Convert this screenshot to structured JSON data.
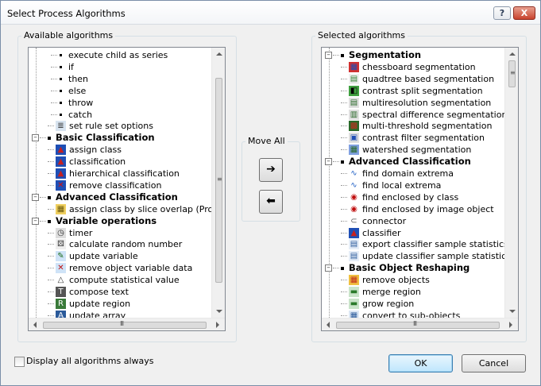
{
  "window": {
    "title": "Select Process Algorithms",
    "help_label": "?",
    "close_label": "X"
  },
  "available": {
    "label": "Available algorithms",
    "rows": [
      {
        "kind": "item",
        "level": 3,
        "text": "execute child as series",
        "icon": ""
      },
      {
        "kind": "item",
        "level": 3,
        "text": "if",
        "icon": ""
      },
      {
        "kind": "item",
        "level": 3,
        "text": "then",
        "icon": ""
      },
      {
        "kind": "item",
        "level": 3,
        "text": "else",
        "icon": ""
      },
      {
        "kind": "item",
        "level": 3,
        "text": "throw",
        "icon": ""
      },
      {
        "kind": "item",
        "level": 3,
        "text": "catch",
        "icon": ""
      },
      {
        "kind": "item",
        "level": 2,
        "text": "set rule set options",
        "icon": "rule-set-options-icon"
      },
      {
        "kind": "cat",
        "text": "Basic Classification"
      },
      {
        "kind": "item",
        "level": 2,
        "text": "assign class",
        "icon": "assign-class-icon"
      },
      {
        "kind": "item",
        "level": 2,
        "text": "classification",
        "icon": "classification-icon"
      },
      {
        "kind": "item",
        "level": 2,
        "text": "hierarchical classification",
        "icon": "hierarchical-classification-icon"
      },
      {
        "kind": "item",
        "level": 2,
        "text": "remove classification",
        "icon": "remove-classification-icon"
      },
      {
        "kind": "cat",
        "text": "Advanced Classification"
      },
      {
        "kind": "item",
        "level": 2,
        "text": "assign class by slice overlap (Prototy",
        "icon": "slice-overlap-icon"
      },
      {
        "kind": "cat",
        "text": "Variable operations"
      },
      {
        "kind": "item",
        "level": 2,
        "text": "timer",
        "icon": "timer-icon"
      },
      {
        "kind": "item",
        "level": 2,
        "text": "calculate random number",
        "icon": "random-number-icon"
      },
      {
        "kind": "item",
        "level": 2,
        "text": "update variable",
        "icon": "update-variable-icon"
      },
      {
        "kind": "item",
        "level": 2,
        "text": "remove object variable data",
        "icon": "remove-variable-icon"
      },
      {
        "kind": "item",
        "level": 2,
        "text": "compute statistical value",
        "icon": "statistics-icon"
      },
      {
        "kind": "item",
        "level": 2,
        "text": "compose text",
        "icon": "compose-text-icon"
      },
      {
        "kind": "item",
        "level": 2,
        "text": "update region",
        "icon": "update-region-icon"
      },
      {
        "kind": "item",
        "level": 2,
        "text": "update array",
        "icon": "update-array-icon"
      }
    ]
  },
  "move_all": {
    "label": "Move All",
    "right_arrow": "➔",
    "left_arrow": "⬅"
  },
  "selected": {
    "label": "Selected algorithms",
    "rows": [
      {
        "kind": "cat",
        "text": "Segmentation"
      },
      {
        "kind": "item",
        "level": 2,
        "text": "chessboard segmentation",
        "icon": "chessboard-icon"
      },
      {
        "kind": "item",
        "level": 2,
        "text": "quadtree based segmentation",
        "icon": "quadtree-icon"
      },
      {
        "kind": "item",
        "level": 2,
        "text": "contrast split segmentation",
        "icon": "contrast-split-icon"
      },
      {
        "kind": "item",
        "level": 2,
        "text": "multiresolution segmentation",
        "icon": "multiresolution-icon"
      },
      {
        "kind": "item",
        "level": 2,
        "text": "spectral difference segmentation",
        "icon": "spectral-difference-icon"
      },
      {
        "kind": "item",
        "level": 2,
        "text": "multi-threshold segmentation",
        "icon": "multi-threshold-icon"
      },
      {
        "kind": "item",
        "level": 2,
        "text": "contrast filter segmentation",
        "icon": "contrast-filter-icon"
      },
      {
        "kind": "item",
        "level": 2,
        "text": "watershed segmentation",
        "icon": "watershed-icon"
      },
      {
        "kind": "cat",
        "text": "Advanced Classification"
      },
      {
        "kind": "item",
        "level": 2,
        "text": "find domain extrema",
        "icon": "domain-extrema-icon"
      },
      {
        "kind": "item",
        "level": 2,
        "text": "find local extrema",
        "icon": "local-extrema-icon"
      },
      {
        "kind": "item",
        "level": 2,
        "text": "find enclosed by class",
        "icon": "enclosed-class-icon"
      },
      {
        "kind": "item",
        "level": 2,
        "text": "find enclosed by image object",
        "icon": "enclosed-object-icon"
      },
      {
        "kind": "item",
        "level": 2,
        "text": "connector",
        "icon": "connector-icon"
      },
      {
        "kind": "item",
        "level": 2,
        "text": "classifier",
        "icon": "classifier-icon"
      },
      {
        "kind": "item",
        "level": 2,
        "text": "export classifier sample statistics",
        "icon": "export-statistics-icon"
      },
      {
        "kind": "item",
        "level": 2,
        "text": "update classifier sample statistics",
        "icon": "update-statistics-icon"
      },
      {
        "kind": "cat",
        "text": "Basic Object Reshaping"
      },
      {
        "kind": "item",
        "level": 2,
        "text": "remove objects",
        "icon": "remove-objects-icon"
      },
      {
        "kind": "item",
        "level": 2,
        "text": "merge region",
        "icon": "merge-region-icon"
      },
      {
        "kind": "item",
        "level": 2,
        "text": "grow region",
        "icon": "grow-region-icon"
      },
      {
        "kind": "item",
        "level": 2,
        "text": "convert to sub-objects",
        "icon": "convert-subobjects-icon"
      }
    ]
  },
  "options": {
    "display_all_label": "Display all algorithms always",
    "display_all_checked": false
  },
  "buttons": {
    "ok": "OK",
    "cancel": "Cancel"
  },
  "scroll": {
    "grip_v": "≡",
    "grip_h": "III"
  }
}
